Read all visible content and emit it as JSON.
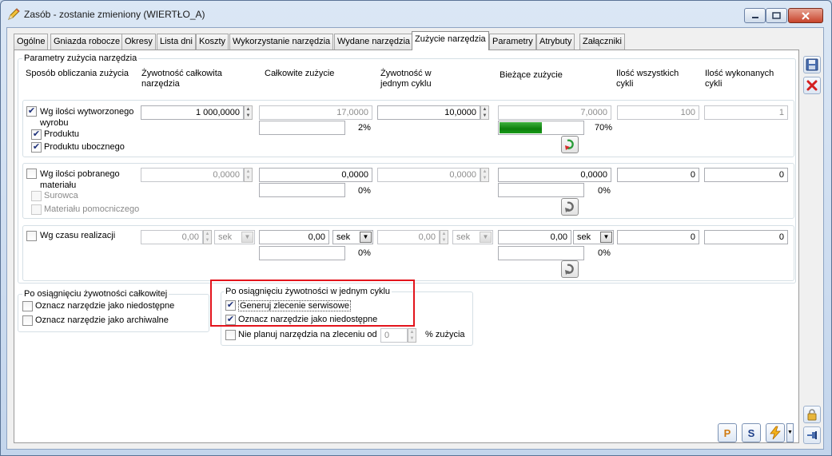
{
  "window": {
    "title": "Zasób - zostanie zmieniony  (WIERTŁO_A)"
  },
  "tabs": [
    {
      "label": "Ogólne"
    },
    {
      "label": "Gniazda robocze"
    },
    {
      "label": "Okresy"
    },
    {
      "label": "Lista dni"
    },
    {
      "label": "Koszty"
    },
    {
      "label": "Wykorzystanie narzędzia"
    },
    {
      "label": "Wydane narzędzia"
    },
    {
      "label": "Zużycie narzędzia"
    },
    {
      "label": "Parametry"
    },
    {
      "label": "Atrybuty"
    },
    {
      "label": "Załączniki"
    }
  ],
  "params_group": {
    "legend": "Parametry zużycia narzędzia",
    "headers": {
      "method": "Sposób obliczania zużycia",
      "total_life": "Żywotność całkowita narzędzia",
      "total_usage": "Całkowite zużycie",
      "cycle_life": "Żywotność w jednym cyklu",
      "current_usage": "Bieżące zużycie",
      "all_cycles": "Ilość wszystkich cykli",
      "done_cycles": "Ilość wykonanych cykli"
    }
  },
  "row1": {
    "label": "Wg ilości wytworzonego wyrobu",
    "checked": true,
    "sub1": "Produktu",
    "sub2": "Produktu ubocznego",
    "total_life": "1 000,0000",
    "total_usage": "17,0000",
    "total_usage_pct": "2%",
    "cycle_life": "10,0000",
    "current_usage": "7,0000",
    "current_pct": "70%",
    "current_fraction": 0.7,
    "all_cycles": "100",
    "done_cycles": "1"
  },
  "row2": {
    "label": "Wg ilości pobranego materiału",
    "sub1": "Surowca",
    "sub2": "Materiału pomocniczego",
    "total_life": "0,0000",
    "total_usage": "0,0000",
    "total_usage_pct": "0%",
    "cycle_life": "0,0000",
    "current_usage": "0,0000",
    "current_pct": "0%",
    "all_cycles": "0",
    "done_cycles": "0"
  },
  "row3": {
    "label": "Wg czasu realizacji",
    "total_life": "0,00",
    "total_life_unit": "sek",
    "total_usage": "0,00",
    "total_usage_unit": "sek",
    "total_usage_pct": "0%",
    "cycle_life": "0,00",
    "cycle_life_unit": "sek",
    "current_usage": "0,00",
    "current_usage_unit": "sek",
    "current_pct": "0%",
    "all_cycles": "0",
    "done_cycles": "0"
  },
  "after_total": {
    "legend": "Po osiągnięciu żywotności całkowitej",
    "opt1": "Oznacz narzędzie jako niedostępne",
    "opt2": "Oznacz narzędzie jako archiwalne"
  },
  "after_cycle": {
    "legend": "Po osiągnięciu żywotności w jednym cyklu",
    "opt1": "Generuj zlecenie serwisowe",
    "opt2": "Oznacz narzędzie jako niedostępne",
    "opt3": "Nie planuj narzędzia na zleceniu od",
    "opt3_value": "0",
    "opt3_suffix": "% zużycia"
  },
  "bottom_buttons": {
    "p_label": "P",
    "s_label": "S"
  },
  "colors": {
    "progress": "#0c7f0c",
    "highlight": "#e3141c"
  }
}
